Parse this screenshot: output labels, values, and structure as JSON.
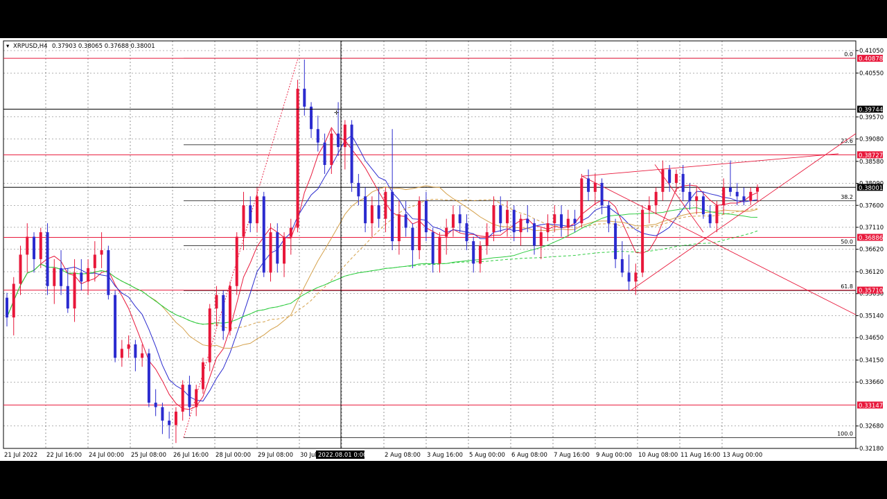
{
  "header": {
    "symbol_label": "XRPUSD,H4",
    "ohlc_label": "0.37903 0.38065 0.37688 0.38001"
  },
  "chart_data": {
    "type": "candlestick",
    "symbol": "XRPUSD",
    "timeframe": "H4",
    "ohlc": {
      "open": 0.37903,
      "high": 0.38065,
      "low": 0.37688,
      "close": 0.38001
    },
    "grid": true,
    "ylim": [
      0.3218,
      0.4105
    ],
    "y_ticks": [
      "0.41050",
      "0.40550",
      "0.39570",
      "0.39080",
      "0.38580",
      "0.38090",
      "0.37600",
      "0.37110",
      "0.36620",
      "0.36120",
      "0.35630",
      "0.35140",
      "0.34650",
      "0.34150",
      "0.33660",
      "0.32680",
      "0.32180"
    ],
    "x_ticks": [
      "21 Jul 2022",
      "22 Jul 16:00",
      "24 Jul 00:00",
      "25 Jul 08:00",
      "26 Jul 16:00",
      "28 Jul 00:00",
      "29 Jul 08:00",
      "30 Jul",
      "00",
      "2 Aug 08:00",
      "3 Aug 16:00",
      "5 Aug 00:00",
      "6 Aug 08:00",
      "7 Aug 16:00",
      "9 Aug 00:00",
      "10 Aug 08:00",
      "11 Aug 16:00",
      "13 Aug 00:00"
    ],
    "crosshair_time_label": "2022.08.01 0:00",
    "price_badges": [
      {
        "label": "0.40878",
        "value": 0.40878,
        "color": "#e8173a"
      },
      {
        "label": "0.39744",
        "value": 0.39744,
        "color": "#000000"
      },
      {
        "label": "0.38727",
        "value": 0.38727,
        "color": "#e8173a"
      },
      {
        "label": "0.38001",
        "value": 0.38001,
        "color": "#000000"
      },
      {
        "label": "0.36886",
        "value": 0.36886,
        "color": "#e8173a"
      },
      {
        "label": "0.35710",
        "value": 0.3571,
        "color": "#e8173a"
      },
      {
        "label": "0.33147",
        "value": 0.33147,
        "color": "#e8173a"
      }
    ],
    "fib_levels": [
      {
        "label": "0.0",
        "value": 0.40878
      },
      {
        "label": "23.6",
        "value": 0.3895
      },
      {
        "label": "38.2",
        "value": 0.377
      },
      {
        "label": "50.0",
        "value": 0.367
      },
      {
        "label": "61.8",
        "value": 0.357
      },
      {
        "label": "100.0",
        "value": 0.3242
      }
    ],
    "candles": [
      [
        0.3554,
        0.3565,
        0.349,
        0.351
      ],
      [
        0.351,
        0.36,
        0.347,
        0.3585
      ],
      [
        0.3585,
        0.367,
        0.356,
        0.365
      ],
      [
        0.365,
        0.372,
        0.361,
        0.369
      ],
      [
        0.369,
        0.37,
        0.361,
        0.364
      ],
      [
        0.364,
        0.371,
        0.362,
        0.37
      ],
      [
        0.37,
        0.372,
        0.356,
        0.358
      ],
      [
        0.358,
        0.364,
        0.354,
        0.362
      ],
      [
        0.362,
        0.366,
        0.356,
        0.358
      ],
      [
        0.358,
        0.362,
        0.352,
        0.353
      ],
      [
        0.353,
        0.364,
        0.35,
        0.361
      ],
      [
        0.361,
        0.364,
        0.357,
        0.359
      ],
      [
        0.359,
        0.364,
        0.356,
        0.362
      ],
      [
        0.362,
        0.368,
        0.359,
        0.365
      ],
      [
        0.365,
        0.37,
        0.362,
        0.366
      ],
      [
        0.366,
        0.367,
        0.355,
        0.356
      ],
      [
        0.356,
        0.357,
        0.341,
        0.342
      ],
      [
        0.342,
        0.346,
        0.34,
        0.344
      ],
      [
        0.344,
        0.347,
        0.342,
        0.345
      ],
      [
        0.345,
        0.346,
        0.339,
        0.342
      ],
      [
        0.342,
        0.345,
        0.34,
        0.343
      ],
      [
        0.343,
        0.344,
        0.331,
        0.332
      ],
      [
        0.332,
        0.335,
        0.329,
        0.331
      ],
      [
        0.331,
        0.332,
        0.325,
        0.328
      ],
      [
        0.328,
        0.33,
        0.324,
        0.327
      ],
      [
        0.327,
        0.331,
        0.323,
        0.33
      ],
      [
        0.33,
        0.337,
        0.328,
        0.336
      ],
      [
        0.336,
        0.338,
        0.329,
        0.331
      ],
      [
        0.331,
        0.336,
        0.329,
        0.335
      ],
      [
        0.335,
        0.342,
        0.334,
        0.341
      ],
      [
        0.341,
        0.354,
        0.339,
        0.353
      ],
      [
        0.353,
        0.358,
        0.349,
        0.356
      ],
      [
        0.356,
        0.357,
        0.346,
        0.348
      ],
      [
        0.348,
        0.359,
        0.347,
        0.358
      ],
      [
        0.358,
        0.37,
        0.356,
        0.369
      ],
      [
        0.369,
        0.379,
        0.366,
        0.376
      ],
      [
        0.376,
        0.378,
        0.37,
        0.372
      ],
      [
        0.372,
        0.38,
        0.37,
        0.378
      ],
      [
        0.378,
        0.379,
        0.36,
        0.361
      ],
      [
        0.361,
        0.372,
        0.359,
        0.37
      ],
      [
        0.37,
        0.372,
        0.361,
        0.363
      ],
      [
        0.363,
        0.37,
        0.36,
        0.369
      ],
      [
        0.369,
        0.373,
        0.365,
        0.371
      ],
      [
        0.371,
        0.404,
        0.37,
        0.402
      ],
      [
        0.402,
        0.4085,
        0.396,
        0.398
      ],
      [
        0.398,
        0.399,
        0.391,
        0.393
      ],
      [
        0.393,
        0.396,
        0.388,
        0.39
      ],
      [
        0.39,
        0.392,
        0.383,
        0.385
      ],
      [
        0.385,
        0.393,
        0.383,
        0.392
      ],
      [
        0.392,
        0.399,
        0.387,
        0.389
      ],
      [
        0.389,
        0.395,
        0.384,
        0.394
      ],
      [
        0.394,
        0.395,
        0.379,
        0.381
      ],
      [
        0.381,
        0.383,
        0.376,
        0.378
      ],
      [
        0.378,
        0.38,
        0.37,
        0.372
      ],
      [
        0.372,
        0.378,
        0.369,
        0.376
      ],
      [
        0.376,
        0.38,
        0.371,
        0.373
      ],
      [
        0.373,
        0.38,
        0.37,
        0.379
      ],
      [
        0.379,
        0.393,
        0.366,
        0.368
      ],
      [
        0.368,
        0.377,
        0.365,
        0.374
      ],
      [
        0.374,
        0.377,
        0.369,
        0.371
      ],
      [
        0.371,
        0.372,
        0.362,
        0.366
      ],
      [
        0.366,
        0.378,
        0.364,
        0.377
      ],
      [
        0.377,
        0.379,
        0.368,
        0.37
      ],
      [
        0.37,
        0.371,
        0.361,
        0.363
      ],
      [
        0.363,
        0.37,
        0.361,
        0.369
      ],
      [
        0.369,
        0.373,
        0.365,
        0.371
      ],
      [
        0.371,
        0.376,
        0.369,
        0.374
      ],
      [
        0.374,
        0.376,
        0.37,
        0.372
      ],
      [
        0.372,
        0.374,
        0.366,
        0.368
      ],
      [
        0.368,
        0.369,
        0.361,
        0.363
      ],
      [
        0.363,
        0.368,
        0.361,
        0.367
      ],
      [
        0.367,
        0.372,
        0.365,
        0.37
      ],
      [
        0.37,
        0.378,
        0.368,
        0.376
      ],
      [
        0.376,
        0.378,
        0.37,
        0.372
      ],
      [
        0.372,
        0.377,
        0.369,
        0.375
      ],
      [
        0.375,
        0.376,
        0.368,
        0.37
      ],
      [
        0.37,
        0.374,
        0.367,
        0.373
      ],
      [
        0.373,
        0.376,
        0.37,
        0.372
      ],
      [
        0.372,
        0.373,
        0.365,
        0.367
      ],
      [
        0.367,
        0.371,
        0.364,
        0.37
      ],
      [
        0.37,
        0.374,
        0.368,
        0.372
      ],
      [
        0.372,
        0.376,
        0.37,
        0.374
      ],
      [
        0.374,
        0.376,
        0.369,
        0.371
      ],
      [
        0.371,
        0.375,
        0.369,
        0.373
      ],
      [
        0.373,
        0.375,
        0.37,
        0.372
      ],
      [
        0.372,
        0.383,
        0.371,
        0.382
      ],
      [
        0.382,
        0.384,
        0.377,
        0.379
      ],
      [
        0.379,
        0.383,
        0.376,
        0.381
      ],
      [
        0.381,
        0.382,
        0.374,
        0.376
      ],
      [
        0.376,
        0.377,
        0.37,
        0.372
      ],
      [
        0.372,
        0.373,
        0.362,
        0.364
      ],
      [
        0.364,
        0.368,
        0.36,
        0.361
      ],
      [
        0.361,
        0.365,
        0.357,
        0.359
      ],
      [
        0.359,
        0.363,
        0.356,
        0.361
      ],
      [
        0.361,
        0.376,
        0.36,
        0.375
      ],
      [
        0.375,
        0.378,
        0.372,
        0.376
      ],
      [
        0.376,
        0.38,
        0.374,
        0.379
      ],
      [
        0.379,
        0.386,
        0.377,
        0.384
      ],
      [
        0.384,
        0.385,
        0.379,
        0.381
      ],
      [
        0.381,
        0.384,
        0.379,
        0.383
      ],
      [
        0.383,
        0.385,
        0.377,
        0.379
      ],
      [
        0.379,
        0.381,
        0.375,
        0.377
      ],
      [
        0.377,
        0.38,
        0.374,
        0.378
      ],
      [
        0.378,
        0.379,
        0.373,
        0.374
      ],
      [
        0.374,
        0.376,
        0.371,
        0.372
      ],
      [
        0.372,
        0.377,
        0.37,
        0.376
      ],
      [
        0.376,
        0.382,
        0.374,
        0.38
      ],
      [
        0.38,
        0.386,
        0.378,
        0.379
      ],
      [
        0.379,
        0.381,
        0.376,
        0.378
      ],
      [
        0.378,
        0.38,
        0.376,
        0.377
      ],
      [
        0.377,
        0.38,
        0.376,
        0.379
      ],
      [
        0.37903,
        0.38065,
        0.37688,
        0.38001
      ]
    ],
    "ma_series": [
      {
        "color": "#e8173a",
        "style": "solid",
        "kind": "fast"
      },
      {
        "color": "#2b2bcf",
        "style": "solid",
        "kind": "medium"
      },
      {
        "color": "#d4a04a",
        "style": "solid",
        "kind": "slow"
      },
      {
        "color": "#d4a04a",
        "style": "dashed",
        "kind": "slow-dashed"
      },
      {
        "color": "#2ecc40",
        "style": "solid",
        "kind": "long"
      },
      {
        "color": "#2ecc40",
        "style": "dashed",
        "kind": "long-dashed"
      }
    ]
  }
}
